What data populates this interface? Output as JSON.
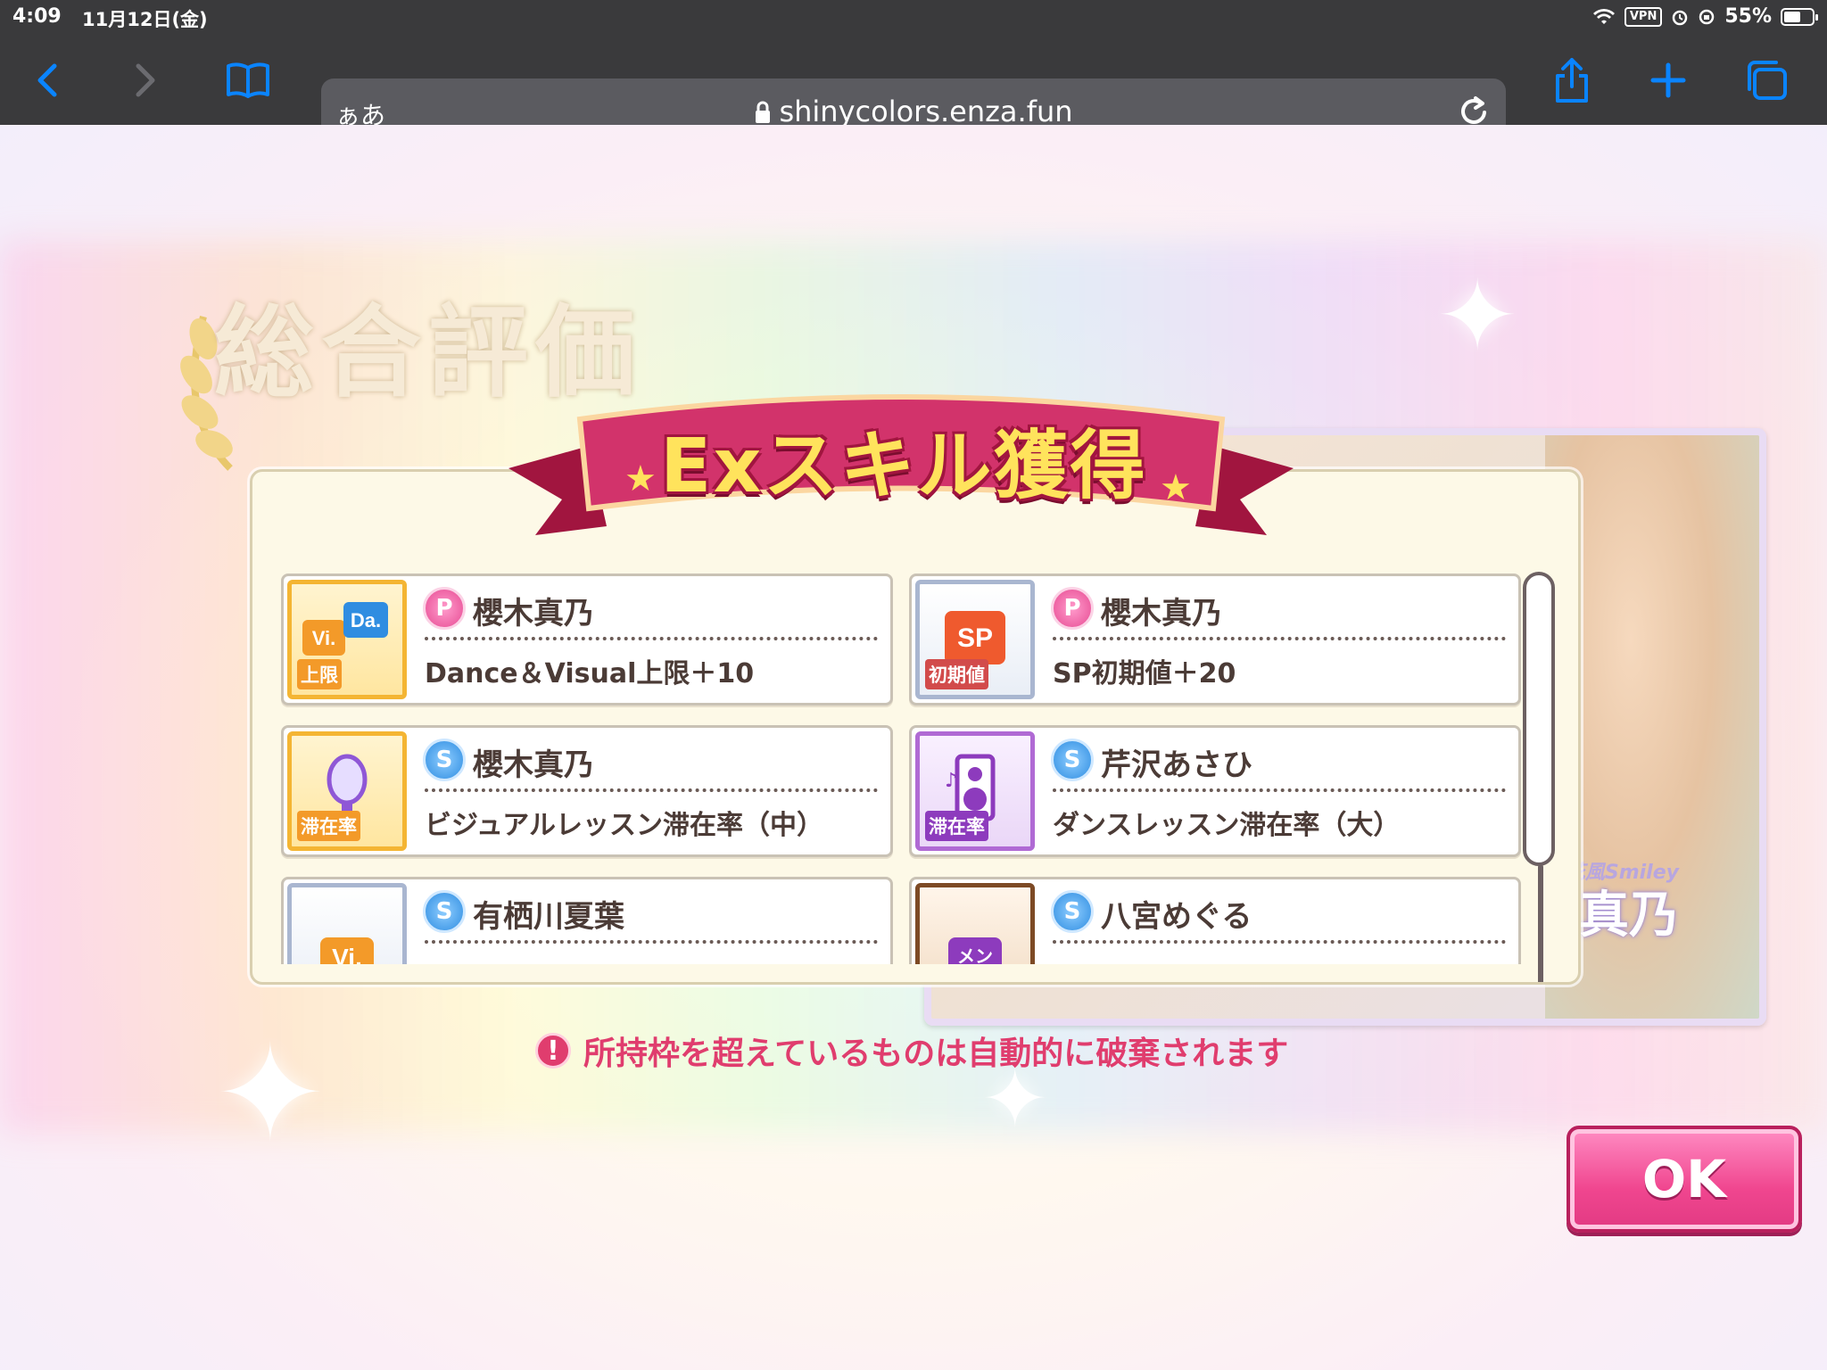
{
  "status_bar": {
    "time": "4:09",
    "date": "11月12日(金)",
    "vpn": "VPN",
    "battery": "55%"
  },
  "browser": {
    "text_size_label": "ぁあ",
    "url": "shinycolors.enza.fun"
  },
  "background": {
    "evaluation_title": "総合評価",
    "card_title": "花風Smiley",
    "card_name": "真乃"
  },
  "modal": {
    "title": "Exスキル獲得",
    "skills": [
      {
        "badge": "P",
        "idol": "櫻木真乃",
        "desc": "Dance＆Visual上限＋10",
        "icon_text": "Vi. Da.",
        "icon_tag": "上限"
      },
      {
        "badge": "P",
        "idol": "櫻木真乃",
        "desc": "SP初期値＋20",
        "icon_text": "SP",
        "icon_tag": "初期値"
      },
      {
        "badge": "S",
        "idol": "櫻木真乃",
        "desc": "ビジュアルレッスン滞在率（中）",
        "icon_text": "mirror",
        "icon_tag": "滞在率"
      },
      {
        "badge": "S",
        "idol": "芹沢あさひ",
        "desc": "ダンスレッスン滞在率（大）",
        "icon_text": "speaker",
        "icon_tag": "滞在率"
      },
      {
        "badge": "S",
        "idol": "有栖川夏葉",
        "desc": "",
        "icon_text": "Vi.",
        "icon_tag": ""
      },
      {
        "badge": "S",
        "idol": "八宮めぐる",
        "desc": "",
        "icon_text": "メンタル",
        "icon_tag": ""
      }
    ]
  },
  "warning": "所持枠を超えているものは自動的に破棄されます",
  "ok_label": "OK",
  "colors": {
    "accent_pink": "#e03d6e",
    "ribbon": "#c2265a",
    "ribbon_text": "#ffe35c"
  },
  "icons": [
    "back-icon",
    "forward-icon",
    "bookmarks-icon",
    "lock-icon",
    "reload-icon",
    "share-icon",
    "add-tab-icon",
    "tabs-icon",
    "wifi-icon",
    "alarm-icon",
    "battery-icon"
  ]
}
